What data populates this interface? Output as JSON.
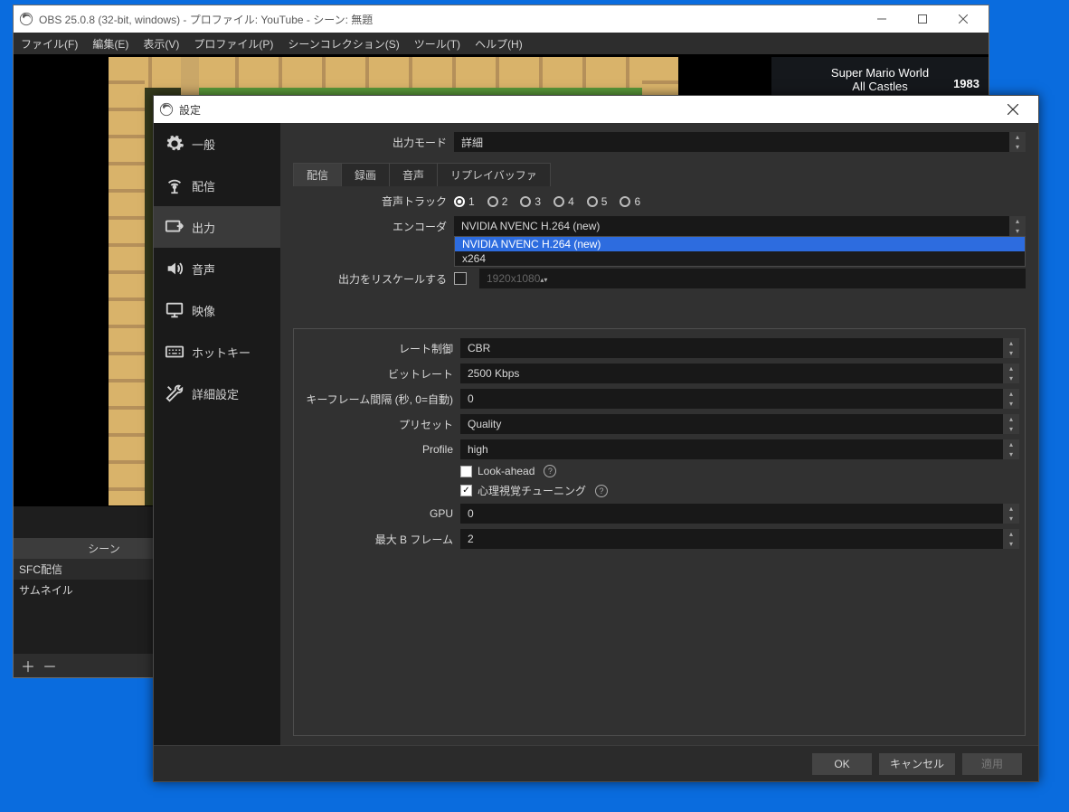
{
  "main": {
    "title": "OBS 25.0.8 (32-bit, windows) - プロファイル: YouTube - シーン: 無題",
    "menus": [
      "ファイル(F)",
      "編集(E)",
      "表示(V)",
      "プロファイル(P)",
      "シーンコレクション(S)",
      "ツール(T)",
      "ヘルプ(H)"
    ],
    "overlay": {
      "title": "Super Mario World",
      "subtitle": "All Castles",
      "year": "1983"
    },
    "scenes_header": "シーン",
    "scenes": [
      "SFC配信",
      "サムネイル"
    ]
  },
  "dialog": {
    "title": "設定",
    "sidebar": [
      {
        "label": "一般",
        "icon": "gear"
      },
      {
        "label": "配信",
        "icon": "antenna"
      },
      {
        "label": "出力",
        "icon": "output",
        "selected": true
      },
      {
        "label": "音声",
        "icon": "speaker"
      },
      {
        "label": "映像",
        "icon": "monitor"
      },
      {
        "label": "ホットキー",
        "icon": "keyboard"
      },
      {
        "label": "詳細設定",
        "icon": "tools"
      }
    ],
    "output_mode": {
      "label": "出力モード",
      "value": "詳細"
    },
    "tabs": [
      "配信",
      "録画",
      "音声",
      "リプレイバッファ"
    ],
    "tab_selected": 0,
    "audio_track": {
      "label": "音声トラック",
      "options": [
        "1",
        "2",
        "3",
        "4",
        "5",
        "6"
      ],
      "selected": 0
    },
    "encoder": {
      "label": "エンコーダ",
      "value": "NVIDIA NVENC H.264 (new)",
      "options": [
        "NVIDIA NVENC H.264 (new)",
        "x264"
      ],
      "highlight": 0
    },
    "rescale": {
      "label": "出力をリスケールする",
      "checked": false,
      "value": "1920x1080"
    },
    "rate_control": {
      "label": "レート制御",
      "value": "CBR"
    },
    "bitrate": {
      "label": "ビットレート",
      "value": "2500 Kbps"
    },
    "keyframe": {
      "label": "キーフレーム間隔 (秒, 0=自動)",
      "value": "0"
    },
    "preset": {
      "label": "プリセット",
      "value": "Quality"
    },
    "profile": {
      "label": "Profile",
      "value": "high"
    },
    "lookahead": {
      "label": "Look-ahead",
      "checked": false
    },
    "psycho": {
      "label": "心理視覚チューニング",
      "checked": true
    },
    "gpu": {
      "label": "GPU",
      "value": "0"
    },
    "bframes": {
      "label": "最大 B フレーム",
      "value": "2"
    },
    "buttons": {
      "ok": "OK",
      "cancel": "キャンセル",
      "apply": "適用"
    }
  }
}
